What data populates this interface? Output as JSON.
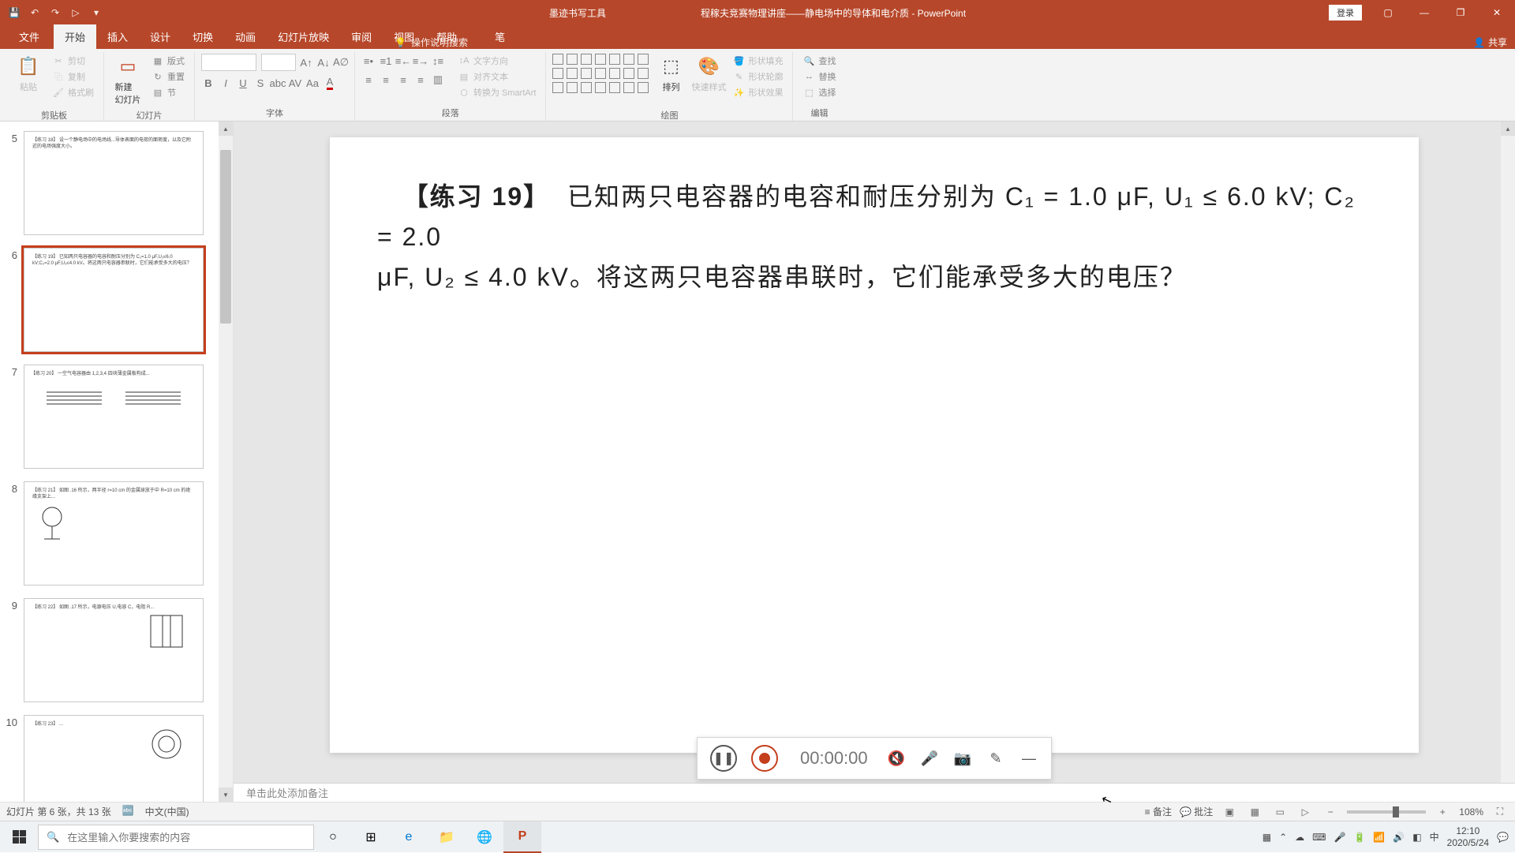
{
  "titlebar": {
    "ink_tools": "墨迹书写工具",
    "title": "程稼夫竞赛物理讲座——静电场中的导体和电介质 - PowerPoint",
    "login": "登录"
  },
  "tabs": {
    "file": "文件",
    "home": "开始",
    "insert": "插入",
    "design": "设计",
    "transitions": "切换",
    "animations": "动画",
    "slideshow": "幻灯片放映",
    "review": "审阅",
    "view": "视图",
    "help": "帮助",
    "pen": "笔",
    "tell_me": "操作说明搜索",
    "share": "共享"
  },
  "ribbon": {
    "clipboard": {
      "paste": "粘贴",
      "cut": "剪切",
      "copy": "复制",
      "format_painter": "格式刷",
      "label": "剪贴板"
    },
    "slides": {
      "new_slide": "新建\n幻灯片",
      "layout": "版式",
      "reset": "重置",
      "section": "节",
      "label": "幻灯片"
    },
    "font": {
      "label": "字体"
    },
    "paragraph": {
      "text_dir": "文字方向",
      "align_text": "对齐文本",
      "smartart": "转换为 SmartArt",
      "label": "段落"
    },
    "drawing": {
      "arrange": "排列",
      "quick_styles": "快速样式",
      "shape_fill": "形状填充",
      "shape_outline": "形状轮廓",
      "shape_effects": "形状效果",
      "label": "绘图"
    },
    "editing": {
      "find": "查找",
      "replace": "替换",
      "select": "选择",
      "label": "编辑"
    }
  },
  "thumbnails": [
    {
      "num": "5"
    },
    {
      "num": "6",
      "active": true
    },
    {
      "num": "7"
    },
    {
      "num": "8"
    },
    {
      "num": "9"
    },
    {
      "num": "10"
    }
  ],
  "slide": {
    "problem_label": "【练习 19】",
    "problem_text_1": "已知两只电容器的电容和耐压分别为 C₁ = 1.0 μF, U₁ ≤ 6.0 kV; C₂ = 2.0",
    "problem_text_2": "μF, U₂ ≤ 4.0 kV。将这两只电容器串联时，它们能承受多大的电压？"
  },
  "notes": {
    "placeholder": "单击此处添加备注"
  },
  "recording": {
    "time": "00:00:00"
  },
  "statusbar": {
    "slide_info": "幻灯片 第 6 张，共 13 张",
    "lang": "中文(中国)",
    "comments": "备注",
    "revisions": "批注",
    "zoom": "108%"
  },
  "taskbar": {
    "search_placeholder": "在这里输入你要搜索的内容",
    "ime": "中",
    "time": "12:10",
    "date": "2020/5/24"
  }
}
